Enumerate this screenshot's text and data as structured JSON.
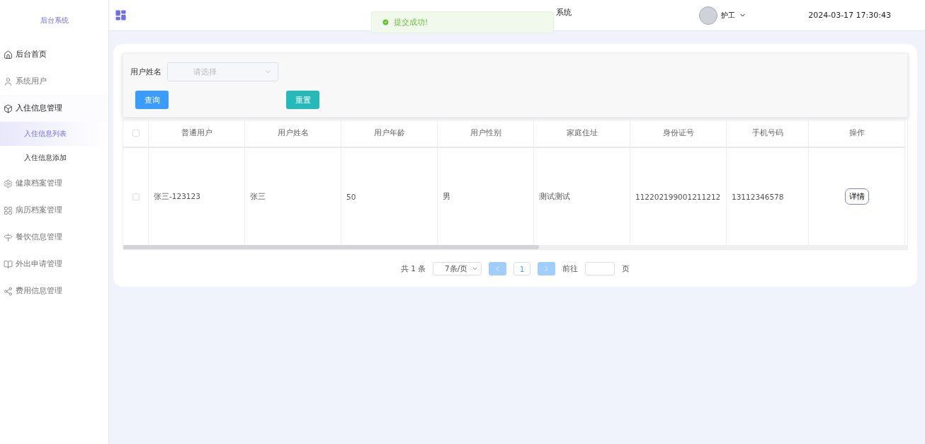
{
  "sidebar": {
    "brand": "后台系统",
    "items": [
      {
        "label": "后台首页",
        "strong": true
      },
      {
        "label": "系统用户",
        "strong": false
      },
      {
        "label": "入住信息管理",
        "strong": true,
        "expanded": true,
        "children": [
          {
            "label": "入住信息列表",
            "selected": true
          },
          {
            "label": "入住信息添加",
            "selected": false
          }
        ]
      },
      {
        "label": "健康档案管理",
        "strong": false
      },
      {
        "label": "病历档案管理",
        "strong": false
      },
      {
        "label": "餐饮信息管理",
        "strong": false
      },
      {
        "label": "外出申请管理",
        "strong": false
      },
      {
        "label": "费用信息管理",
        "strong": false
      }
    ]
  },
  "header": {
    "title": "系统",
    "user": "护工",
    "datetime": "2024-03-17 17:30:43"
  },
  "toast": {
    "message": "提交成功!"
  },
  "filter": {
    "label": "用户姓名",
    "placeholder": "请选择",
    "buttons": [
      {
        "label": "查询",
        "kind": "primary"
      },
      {
        "label": "重置",
        "kind": "reset"
      }
    ]
  },
  "table": {
    "columns": [
      "普通用户",
      "用户姓名",
      "用户年龄",
      "用户性别",
      "家庭住址",
      "身份证号",
      "手机号码",
      "操作"
    ],
    "rows": [
      {
        "checked": false,
        "cells": [
          "张三-123123",
          "张三",
          "50",
          "男",
          "测试测试",
          "112202199001211212",
          "13112346578"
        ],
        "action": "详情"
      }
    ],
    "header_checked": false
  },
  "pagination": {
    "total": "共 1 条",
    "page_size": "7条/页",
    "pages": [
      {
        "label": "1",
        "selected": true
      }
    ],
    "goto": "前往",
    "page_unit": "页"
  }
}
